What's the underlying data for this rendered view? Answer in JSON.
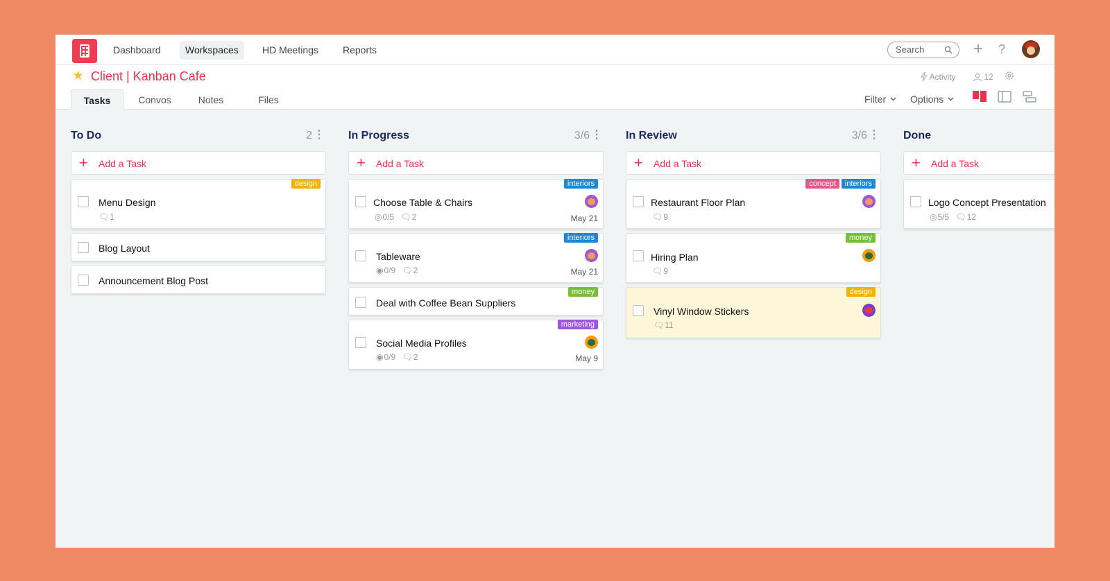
{
  "nav": {
    "items": [
      "Dashboard",
      "Workspaces",
      "HD Meetings",
      "Reports"
    ],
    "search_placeholder": "Search"
  },
  "project": {
    "title": "Client | Kanban Cafe",
    "activity_label": "Activity",
    "member_count": "12"
  },
  "tabs": [
    "Tasks",
    "Convos",
    "Notes",
    "Files"
  ],
  "toolbar": {
    "filter_label": "Filter",
    "options_label": "Options"
  },
  "colors": {
    "accent": "#e8344e",
    "column_title": "#1b2a5e",
    "tag_design": "#f0b400",
    "tag_interiors": "#1e88d8",
    "tag_concept": "#e6578c",
    "tag_money": "#77be39",
    "tag_marketing": "#9b55e0"
  },
  "add_task_label": "Add a Task",
  "columns": [
    {
      "title": "To Do",
      "count": "2",
      "cards": [
        {
          "title": "Menu Design",
          "tags": [
            "design"
          ],
          "comments": "1"
        },
        {
          "title": "Blog Layout"
        },
        {
          "title": "Announcement Blog Post"
        }
      ]
    },
    {
      "title": "In Progress",
      "count": "3/6",
      "cards": [
        {
          "title": "Choose Table & Chairs",
          "tags": [
            "interiors"
          ],
          "checklist": "0/5",
          "comments": "2",
          "due": "May 21"
        },
        {
          "title": "Tableware",
          "tags": [
            "interiors"
          ],
          "checklist": "0/9",
          "comments": "2",
          "due": "May 21"
        },
        {
          "title": "Deal with Coffee Bean Suppliers",
          "tags": [
            "money"
          ]
        },
        {
          "title": "Social Media Profiles",
          "tags": [
            "marketing"
          ],
          "checklist": "0/9",
          "comments": "2",
          "due": "May 9"
        }
      ]
    },
    {
      "title": "In Review",
      "count": "3/6",
      "cards": [
        {
          "title": "Restaurant Floor Plan",
          "tags": [
            "concept",
            "interiors"
          ],
          "comments": "9"
        },
        {
          "title": "Hiring Plan",
          "tags": [
            "money"
          ],
          "comments": "9"
        },
        {
          "title": "Vinyl Window Stickers",
          "tags": [
            "design"
          ],
          "comments": "11"
        }
      ]
    },
    {
      "title": "Done",
      "cards": [
        {
          "title": "Logo Concept Presentation",
          "checklist": "5/5",
          "comments": "12"
        }
      ]
    }
  ]
}
